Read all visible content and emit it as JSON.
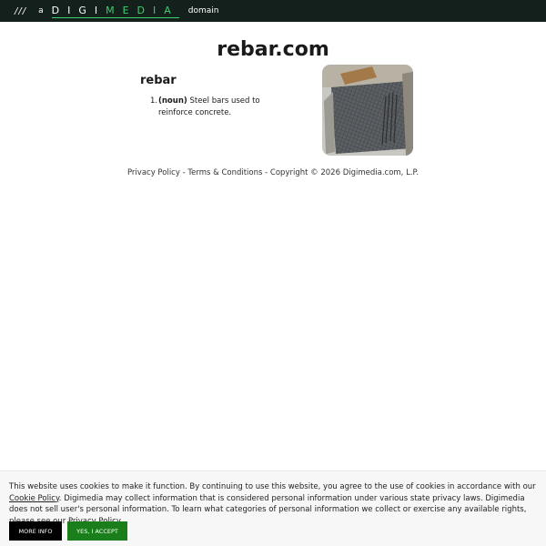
{
  "topbar": {
    "slashes": "///",
    "prefix": "a",
    "brand_white": "DIGI",
    "brand_green": "MEDIA",
    "suffix": "domain"
  },
  "main": {
    "site_title": "rebar.com",
    "term": "rebar",
    "definitions": [
      {
        "number": "1.",
        "pos": "(noun)",
        "text": "Steel bars used to reinforce concrete."
      }
    ],
    "image_icon": "rebar-photo-icon"
  },
  "footer": {
    "privacy": "Privacy Policy",
    "sep1": " - ",
    "terms": "Terms & Conditions",
    "sep2": " - ",
    "copyright": "Copyright © 2026 Digimedia.com, L.P."
  },
  "cookie": {
    "text1": "This website uses cookies to make it function. By continuing to use this website, you agree to the use of cookies in accordance with our ",
    "link1": "Cookie Policy",
    "text2": ". Digimedia may collect information that is considered personal information under various state privacy laws. Digimedia does not sell user's personal information. To learn what categories of personal information we collect or exercise any available rights, please see our ",
    "link2": "Privacy Policy",
    "text3": ".",
    "more_info": "MORE INFO",
    "accept": "YES, I ACCEPT"
  },
  "colors": {
    "topbar_bg": "#14201c",
    "brand_accent": "#3ccf6d",
    "accept_button": "#1a7f1a",
    "info_button": "#000000"
  }
}
